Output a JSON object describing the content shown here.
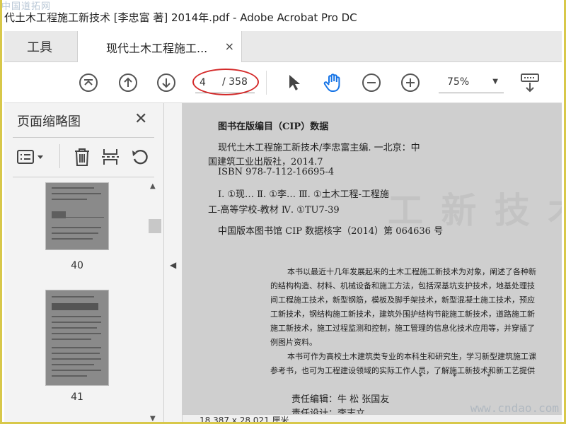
{
  "window": {
    "title": "代土木工程施工新技术 [李忠富 著] 2014年.pdf - Adobe Acrobat Pro DC",
    "watermark": "中国道拓网"
  },
  "tabs": {
    "tools_prefix": "",
    "tools_label": "工具",
    "doc_label": "现代土木工程施工...",
    "close_glyph": "×"
  },
  "toolbar": {
    "current_page": "4",
    "total_pages": "/ 358",
    "zoom": "75%",
    "highlight_color": "#d42a2a",
    "accent_color": "#1473e6"
  },
  "sidepanel": {
    "title": "页面缩略图",
    "close_glyph": "✕",
    "thumbnails": [
      {
        "label": "40"
      },
      {
        "label": "41"
      }
    ]
  },
  "document": {
    "cip_heading": "图书在版编目（CIP）数据",
    "cip_line1": "现代土木工程施工新技术/李忠富主编. 一北京：中",
    "cip_line2": "国建筑工业出版社，2014.7",
    "cip_line3": "ISBN 978-7-112-16695-4",
    "cip_line4": "Ⅰ. ①现…  Ⅱ. ①李…  Ⅲ. ①土木工程-工程施",
    "cip_line5": "工-高等学校-教材  Ⅳ. ①TU7-39",
    "cip_line6": "中国版本图书馆 CIP 数据核字（2014）第 064636 号",
    "para_lines": [
      "本书以最近十几年发展起来的土木工程施工新技术为对象，阐述了各种新",
      "的结构构造、材料、机械设备和施工方法，包括深基坑支护技术，地基处理技",
      "间工程施工技术，新型钢筋，模板及脚手架技术，新型混凝土施工技术，预应",
      "工新技术，钢结构施工新技术，建筑外围护结构节能施工新技术，道路施工新",
      "施工新技术，施工过程监测和控制，施工管理的信息化技术应用等，并穿插了",
      "例图片资料。",
      "本书可作为高校土木建筑类专业的本科生和研究生，学习新型建筑施工课",
      "参考书，也可为工程建设领域的实际工作人员，了解施工新技术和新工艺提供"
    ],
    "stars": "* * *",
    "editor": "责任编辑：牛  松  张国友",
    "designer": "责任设计：李志立",
    "ghost_watermark": "工 新 技 术 工 木 土"
  },
  "status": {
    "page_size": "18.387 x 28.021 厘米"
  },
  "site_watermark": "www.cndao.com"
}
